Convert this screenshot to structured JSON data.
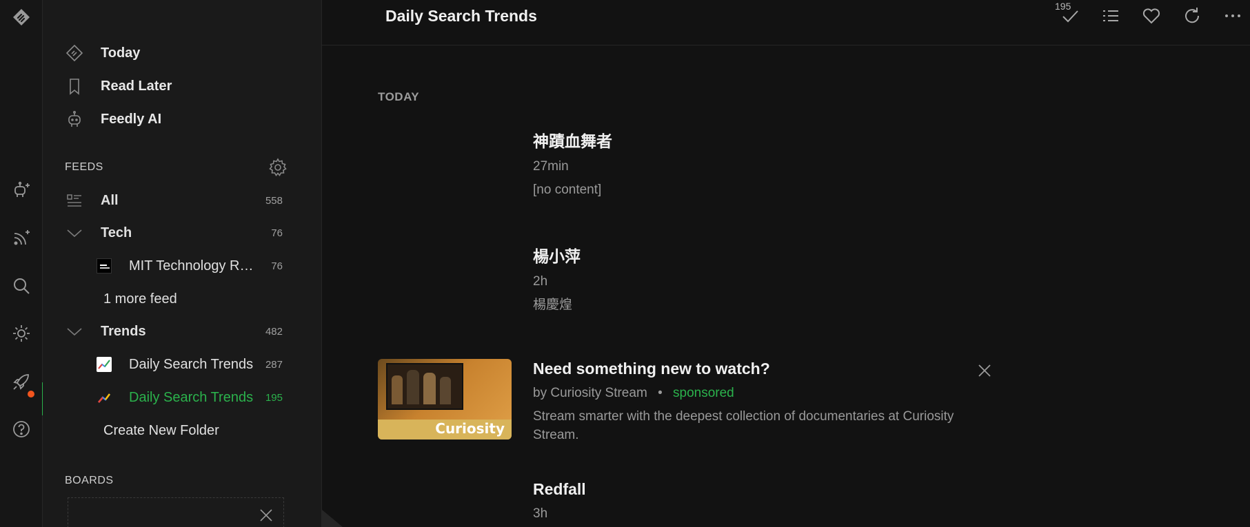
{
  "header": {
    "title": "Daily Search Trends",
    "unread_count": "195"
  },
  "sidebar": {
    "nav": [
      {
        "label": "Today",
        "icon": "feedly-today-icon"
      },
      {
        "label": "Read Later",
        "icon": "bookmark-icon"
      },
      {
        "label": "Feedly AI",
        "icon": "robot-icon"
      }
    ],
    "feeds_label": "FEEDS",
    "all": {
      "label": "All",
      "count": "558"
    },
    "tech": {
      "label": "Tech",
      "count": "76"
    },
    "mit": {
      "label": "MIT Technology R…",
      "count": "76"
    },
    "more_feed": "1 more feed",
    "trends": {
      "label": "Trends",
      "count": "482"
    },
    "dst1": {
      "label": "Daily Search Trends",
      "count": "287"
    },
    "dst2": {
      "label": "Daily Search Trends",
      "count": "195"
    },
    "create_folder": "Create New Folder",
    "boards_label": "BOARDS"
  },
  "main": {
    "section_label": "TODAY",
    "entries": [
      {
        "title": "神蹟血舞者",
        "meta": "27min",
        "summary": "[no content]"
      },
      {
        "title": "楊小萍",
        "meta": "2h",
        "summary": "楊慶煌"
      },
      {
        "title": "Need something new to watch?",
        "by": "by Curiosity Stream",
        "sep": "•",
        "sponsored": "sponsored",
        "summary": "Stream smarter with the deepest collection of documentaries at Curiosity Stream.",
        "thumb_text": "Curiosity"
      },
      {
        "title": "Redfall",
        "meta": "3h"
      }
    ]
  },
  "colors": {
    "accent": "#2bb24c",
    "notification": "#f2551e",
    "background": "#121212"
  }
}
